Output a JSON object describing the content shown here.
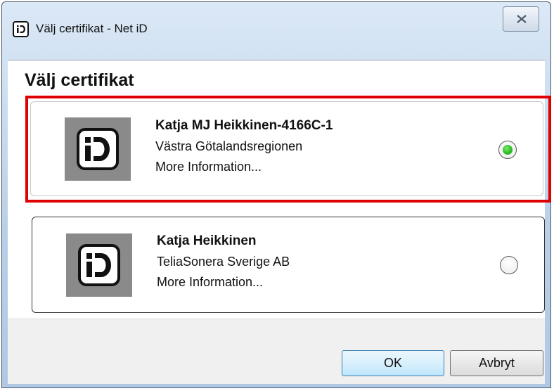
{
  "window": {
    "title": "Välj certifikat - Net iD",
    "close_icon": "close-icon",
    "app_icon": "net-id-logo-icon"
  },
  "main": {
    "heading": "Välj certifikat",
    "certificates": [
      {
        "name": "Katja MJ Heikkinen-4166C-1",
        "issuer": "Västra Götalandsregionen",
        "more": "More Information...",
        "selected": true
      },
      {
        "name": "Katja Heikkinen",
        "issuer": "TeliaSonera Sverige AB",
        "more": "More Information...",
        "selected": false
      }
    ]
  },
  "footer": {
    "ok_label": "OK",
    "cancel_label": "Avbryt"
  },
  "colors": {
    "highlight": "#e00000",
    "radio_selected": "#2fbd25",
    "logo_background": "#8a8a8a"
  }
}
